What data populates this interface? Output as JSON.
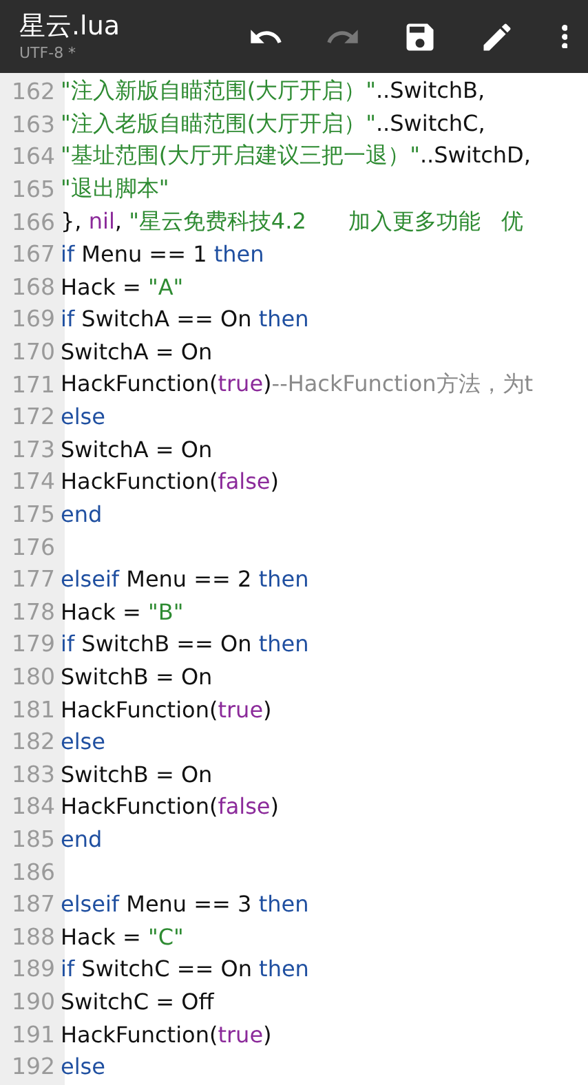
{
  "app_bar": {
    "title": "星云.lua",
    "subtitle": "UTF-8 *",
    "tools": [
      {
        "kind": "undo",
        "disabled": false
      },
      {
        "kind": "redo",
        "disabled": true
      },
      {
        "kind": "save",
        "disabled": false
      },
      {
        "kind": "edit",
        "disabled": false
      },
      {
        "kind": "more",
        "disabled": false
      }
    ]
  },
  "code_lines": [
    {
      "number": "162",
      "tokens": [
        {
          "kind": "string",
          "text": "\"注入新版自瞄范围(大厅开启）\""
        },
        {
          "kind": "plain",
          "text": "..SwitchB,"
        }
      ]
    },
    {
      "number": "163",
      "tokens": [
        {
          "kind": "string",
          "text": "\"注入老版自瞄范围(大厅开启）\""
        },
        {
          "kind": "plain",
          "text": "..SwitchC,"
        }
      ]
    },
    {
      "number": "164",
      "tokens": [
        {
          "kind": "string",
          "text": "\"基址范围(大厅开启建议三把一退）\""
        },
        {
          "kind": "plain",
          "text": "..SwitchD,"
        }
      ]
    },
    {
      "number": "165",
      "tokens": [
        {
          "kind": "string",
          "text": "\"退出脚本\""
        }
      ]
    },
    {
      "number": "166",
      "tokens": [
        {
          "kind": "plain",
          "text": "}, "
        },
        {
          "kind": "literal",
          "text": "nil"
        },
        {
          "kind": "plain",
          "text": ", "
        },
        {
          "kind": "string",
          "text": "\"星云免费科技4.2      加入更多功能   优"
        }
      ]
    },
    {
      "number": "167",
      "tokens": [
        {
          "kind": "keyword",
          "text": "if"
        },
        {
          "kind": "plain",
          "text": " Menu == 1 "
        },
        {
          "kind": "keyword",
          "text": "then"
        }
      ]
    },
    {
      "number": "168",
      "tokens": [
        {
          "kind": "plain",
          "text": "Hack = "
        },
        {
          "kind": "string",
          "text": "\"A\""
        }
      ]
    },
    {
      "number": "169",
      "tokens": [
        {
          "kind": "keyword",
          "text": "if"
        },
        {
          "kind": "plain",
          "text": " SwitchA == On "
        },
        {
          "kind": "keyword",
          "text": "then"
        }
      ]
    },
    {
      "number": "170",
      "tokens": [
        {
          "kind": "plain",
          "text": "SwitchA = On"
        }
      ]
    },
    {
      "number": "171",
      "tokens": [
        {
          "kind": "plain",
          "text": "HackFunction("
        },
        {
          "kind": "literal",
          "text": "true"
        },
        {
          "kind": "plain",
          "text": ")"
        },
        {
          "kind": "comment",
          "text": "--HackFunction方法，为t"
        }
      ]
    },
    {
      "number": "172",
      "tokens": [
        {
          "kind": "keyword",
          "text": "else"
        }
      ]
    },
    {
      "number": "173",
      "tokens": [
        {
          "kind": "plain",
          "text": "SwitchA = On"
        }
      ]
    },
    {
      "number": "174",
      "tokens": [
        {
          "kind": "plain",
          "text": "HackFunction("
        },
        {
          "kind": "literal",
          "text": "false"
        },
        {
          "kind": "plain",
          "text": ")"
        }
      ]
    },
    {
      "number": "175",
      "tokens": [
        {
          "kind": "keyword",
          "text": "end"
        }
      ]
    },
    {
      "number": "176"
    },
    {
      "number": "177",
      "tokens": [
        {
          "kind": "keyword",
          "text": "elseif"
        },
        {
          "kind": "plain",
          "text": " Menu == 2 "
        },
        {
          "kind": "keyword",
          "text": "then"
        }
      ]
    },
    {
      "number": "178",
      "tokens": [
        {
          "kind": "plain",
          "text": "Hack = "
        },
        {
          "kind": "string",
          "text": "\"B\""
        }
      ]
    },
    {
      "number": "179",
      "tokens": [
        {
          "kind": "keyword",
          "text": "if"
        },
        {
          "kind": "plain",
          "text": " SwitchB == On "
        },
        {
          "kind": "keyword",
          "text": "then"
        }
      ]
    },
    {
      "number": "180",
      "tokens": [
        {
          "kind": "plain",
          "text": "SwitchB = On"
        }
      ]
    },
    {
      "number": "181",
      "tokens": [
        {
          "kind": "plain",
          "text": "HackFunction("
        },
        {
          "kind": "literal",
          "text": "true"
        },
        {
          "kind": "plain",
          "text": ")"
        }
      ]
    },
    {
      "number": "182",
      "tokens": [
        {
          "kind": "keyword",
          "text": "else"
        }
      ]
    },
    {
      "number": "183",
      "tokens": [
        {
          "kind": "plain",
          "text": "SwitchB = On"
        }
      ]
    },
    {
      "number": "184",
      "tokens": [
        {
          "kind": "plain",
          "text": "HackFunction("
        },
        {
          "kind": "literal",
          "text": "false"
        },
        {
          "kind": "plain",
          "text": ")"
        }
      ]
    },
    {
      "number": "185",
      "tokens": [
        {
          "kind": "keyword",
          "text": "end"
        }
      ]
    },
    {
      "number": "186"
    },
    {
      "number": "187",
      "tokens": [
        {
          "kind": "keyword",
          "text": "elseif"
        },
        {
          "kind": "plain",
          "text": " Menu == 3 "
        },
        {
          "kind": "keyword",
          "text": "then"
        }
      ]
    },
    {
      "number": "188",
      "tokens": [
        {
          "kind": "plain",
          "text": "Hack = "
        },
        {
          "kind": "string",
          "text": "\"C\""
        }
      ]
    },
    {
      "number": "189",
      "tokens": [
        {
          "kind": "keyword",
          "text": "if"
        },
        {
          "kind": "plain",
          "text": " SwitchC == On "
        },
        {
          "kind": "keyword",
          "text": "then"
        }
      ]
    },
    {
      "number": "190",
      "tokens": [
        {
          "kind": "plain",
          "text": "SwitchC = Off"
        }
      ]
    },
    {
      "number": "191",
      "tokens": [
        {
          "kind": "plain",
          "text": "HackFunction("
        },
        {
          "kind": "literal",
          "text": "true"
        },
        {
          "kind": "plain",
          "text": ")"
        }
      ]
    },
    {
      "number": "192",
      "tokens": [
        {
          "kind": "keyword",
          "text": "else"
        }
      ]
    }
  ]
}
